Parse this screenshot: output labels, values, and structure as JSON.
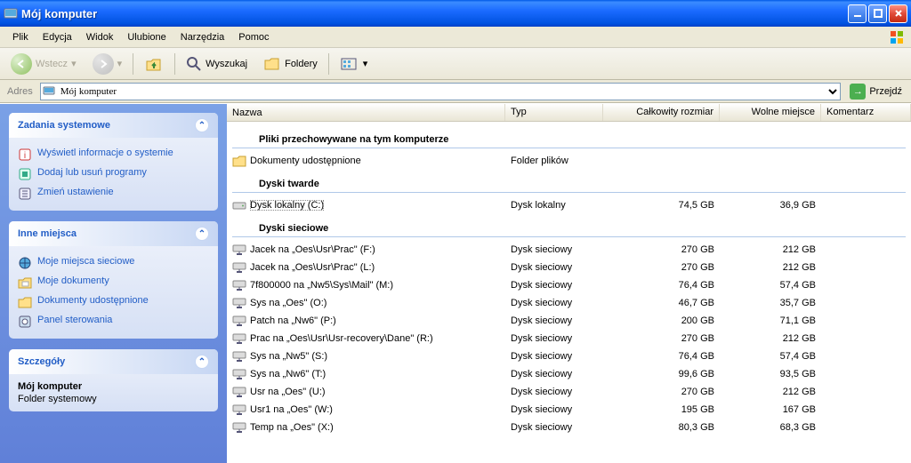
{
  "window": {
    "title": "Mój komputer"
  },
  "menubar": {
    "items": [
      "Plik",
      "Edycja",
      "Widok",
      "Ulubione",
      "Narzędzia",
      "Pomoc"
    ]
  },
  "toolbar": {
    "back": "Wstecz",
    "search": "Wyszukaj",
    "folders": "Foldery"
  },
  "addressbar": {
    "label": "Adres",
    "value": "Mój komputer",
    "go": "Przejdź"
  },
  "columns": {
    "name": "Nazwa",
    "type": "Typ",
    "total": "Całkowity rozmiar",
    "free": "Wolne miejsce",
    "comment": "Komentarz"
  },
  "sidebar": {
    "panels": [
      {
        "title": "Zadania systemowe",
        "links": [
          {
            "icon": "info-icon",
            "label": "Wyświetl informacje o systemie"
          },
          {
            "icon": "programs-icon",
            "label": "Dodaj lub usuń programy"
          },
          {
            "icon": "settings-icon",
            "label": "Zmień ustawienie"
          }
        ]
      },
      {
        "title": "Inne miejsca",
        "links": [
          {
            "icon": "network-icon",
            "label": "Moje miejsca sieciowe"
          },
          {
            "icon": "docs-icon",
            "label": "Moje dokumenty"
          },
          {
            "icon": "shared-docs-icon",
            "label": "Dokumenty udostępnione"
          },
          {
            "icon": "control-panel-icon",
            "label": "Panel sterowania"
          }
        ]
      },
      {
        "title": "Szczegóły",
        "detail": {
          "name": "Mój komputer",
          "desc": "Folder systemowy"
        }
      }
    ]
  },
  "main": {
    "groups": [
      {
        "header": "Pliki przechowywane na tym komputerze",
        "items": [
          {
            "icon": "folder-icon",
            "name": "Dokumenty udostępnione",
            "type": "Folder plików",
            "total": "",
            "free": ""
          }
        ]
      },
      {
        "header": "Dyski twarde",
        "items": [
          {
            "icon": "hdd-icon",
            "name": "Dysk lokalny (C:)",
            "type": "Dysk lokalny",
            "total": "74,5 GB",
            "free": "36,9 GB",
            "selected": true
          }
        ]
      },
      {
        "header": "Dyski sieciowe",
        "items": [
          {
            "icon": "netdrive-icon",
            "name": "Jacek na „Oes\\Usr\\Prac\" (F:)",
            "type": "Dysk sieciowy",
            "total": "270 GB",
            "free": "212 GB"
          },
          {
            "icon": "netdrive-icon",
            "name": "Jacek na „Oes\\Usr\\Prac\" (L:)",
            "type": "Dysk sieciowy",
            "total": "270 GB",
            "free": "212 GB"
          },
          {
            "icon": "netdrive-icon",
            "name": "7f800000 na „Nw5\\Sys\\Mail\" (M:)",
            "type": "Dysk sieciowy",
            "total": "76,4 GB",
            "free": "57,4 GB"
          },
          {
            "icon": "netdrive-icon",
            "name": "Sys na „Oes\" (O:)",
            "type": "Dysk sieciowy",
            "total": "46,7 GB",
            "free": "35,7 GB"
          },
          {
            "icon": "netdrive-icon",
            "name": "Patch na „Nw6\" (P:)",
            "type": "Dysk sieciowy",
            "total": "200 GB",
            "free": "71,1 GB"
          },
          {
            "icon": "netdrive-icon",
            "name": "Prac na „Oes\\Usr\\Usr-recovery\\Dane\" (R:)",
            "type": "Dysk sieciowy",
            "total": "270 GB",
            "free": "212 GB"
          },
          {
            "icon": "netdrive-icon",
            "name": "Sys na „Nw5\" (S:)",
            "type": "Dysk sieciowy",
            "total": "76,4 GB",
            "free": "57,4 GB"
          },
          {
            "icon": "netdrive-icon",
            "name": "Sys na „Nw6\" (T:)",
            "type": "Dysk sieciowy",
            "total": "99,6 GB",
            "free": "93,5 GB"
          },
          {
            "icon": "netdrive-icon",
            "name": "Usr na „Oes\" (U:)",
            "type": "Dysk sieciowy",
            "total": "270 GB",
            "free": "212 GB"
          },
          {
            "icon": "netdrive-icon",
            "name": "Usr1 na „Oes\" (W:)",
            "type": "Dysk sieciowy",
            "total": "195 GB",
            "free": "167 GB"
          },
          {
            "icon": "netdrive-icon",
            "name": "Temp na „Oes\" (X:)",
            "type": "Dysk sieciowy",
            "total": "80,3 GB",
            "free": "68,3 GB"
          }
        ]
      }
    ]
  }
}
